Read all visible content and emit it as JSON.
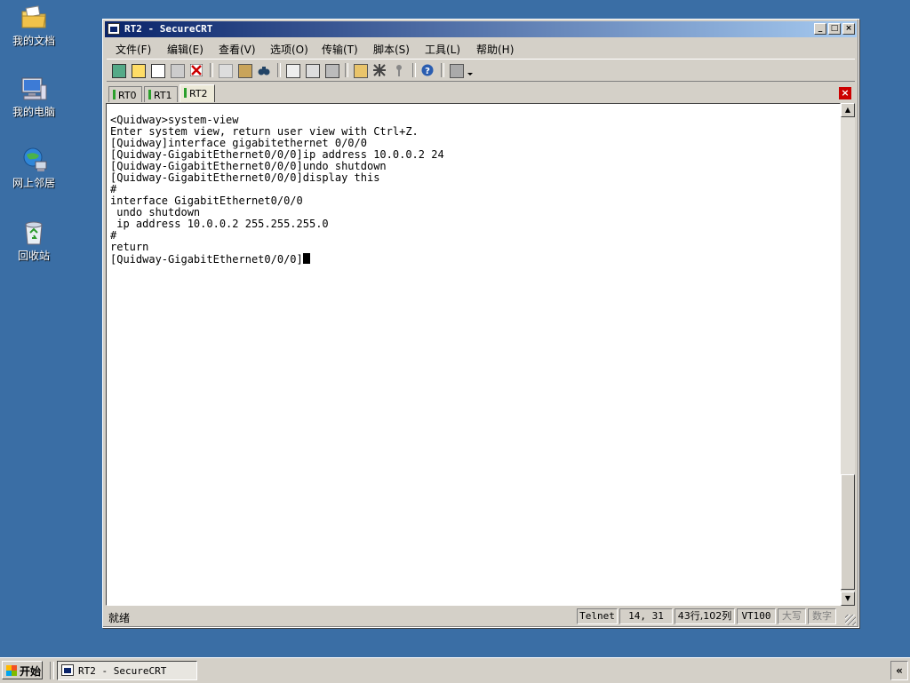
{
  "desktop": {
    "icons": [
      {
        "label": "我的文档",
        "icon": "my-documents-icon"
      },
      {
        "label": "我的电脑",
        "icon": "my-computer-icon"
      },
      {
        "label": "网上邻居",
        "icon": "network-places-icon"
      },
      {
        "label": "回收站",
        "icon": "recycle-bin-icon"
      }
    ]
  },
  "window": {
    "title": "RT2 - SecureCRT",
    "controls": {
      "minimize": "_",
      "maximize": "□",
      "close": "×"
    }
  },
  "menubar": {
    "items": [
      "文件(F)",
      "编辑(E)",
      "查看(V)",
      "选项(O)",
      "传输(T)",
      "脚本(S)",
      "工具(L)",
      "帮助(H)"
    ]
  },
  "toolbar": {
    "buttons": [
      "connect-icon",
      "quick-connect-icon",
      "connect-tab-icon",
      "reconnect-icon",
      "disconnect-icon",
      "copy-icon",
      "paste-icon",
      "find-icon",
      "print-icon",
      "print-selection-icon",
      "print-setup-icon",
      "session-options-icon",
      "global-options-icon",
      "keymap-icon",
      "help-icon",
      "sftp-icon"
    ]
  },
  "tabs": {
    "items": [
      {
        "label": "RT0",
        "active": false
      },
      {
        "label": "RT1",
        "active": false
      },
      {
        "label": "RT2",
        "active": true
      }
    ],
    "close": "×"
  },
  "terminal": {
    "lines": [
      "<Quidway>system-view",
      "Enter system view, return user view with Ctrl+Z.",
      "[Quidway]interface gigabitethernet 0/0/0",
      "[Quidway-GigabitEthernet0/0/0]ip address 10.0.0.2 24",
      "[Quidway-GigabitEthernet0/0/0]undo shutdown",
      "[Quidway-GigabitEthernet0/0/0]display this",
      "#",
      "interface GigabitEthernet0/0/0",
      " undo shutdown",
      " ip address 10.0.0.2 255.255.255.0",
      "#",
      "return",
      "[Quidway-GigabitEthernet0/0/0]"
    ]
  },
  "statusbar": {
    "ready": "就绪",
    "protocol": "Telnet",
    "cursor_pos": "14,  31",
    "size": "43行,102列",
    "emulation": "VT100",
    "caps": "大写",
    "num": "数字"
  },
  "taskbar": {
    "start": "开始",
    "task_title": "RT2 - SecureCRT",
    "tray_chevron": "«"
  }
}
